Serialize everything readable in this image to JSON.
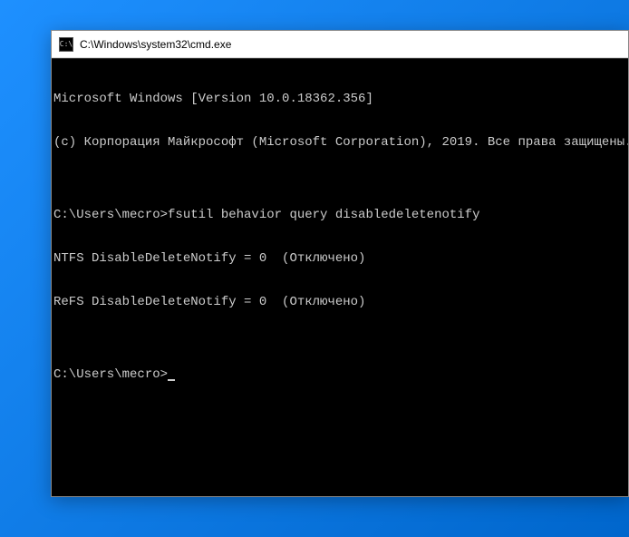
{
  "window": {
    "title": "C:\\Windows\\system32\\cmd.exe",
    "icon_label": "C:\\"
  },
  "terminal": {
    "lines": [
      "Microsoft Windows [Version 10.0.18362.356]",
      "(c) Корпорация Майкрософт (Microsoft Corporation), 2019. Все права защищены.",
      "",
      "C:\\Users\\mecro>fsutil behavior query disabledeletenotify",
      "NTFS DisableDeleteNotify = 0  (Отключено)",
      "ReFS DisableDeleteNotify = 0  (Отключено)",
      "",
      "C:\\Users\\mecro>"
    ]
  }
}
